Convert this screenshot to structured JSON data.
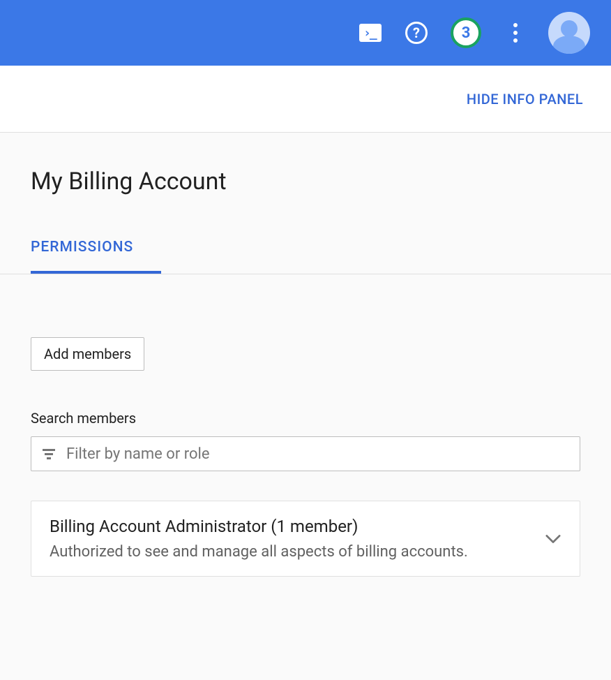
{
  "header": {
    "notification_count": "3"
  },
  "subheader": {
    "hide_panel_label": "HIDE INFO PANEL"
  },
  "page": {
    "title": "My Billing Account"
  },
  "tabs": {
    "permissions_label": "PERMISSIONS"
  },
  "actions": {
    "add_members_label": "Add members"
  },
  "search": {
    "label": "Search members",
    "placeholder": "Filter by name or role"
  },
  "roles": [
    {
      "title": "Billing Account Administrator (1 member)",
      "description": "Authorized to see and manage all aspects of billing accounts."
    }
  ]
}
